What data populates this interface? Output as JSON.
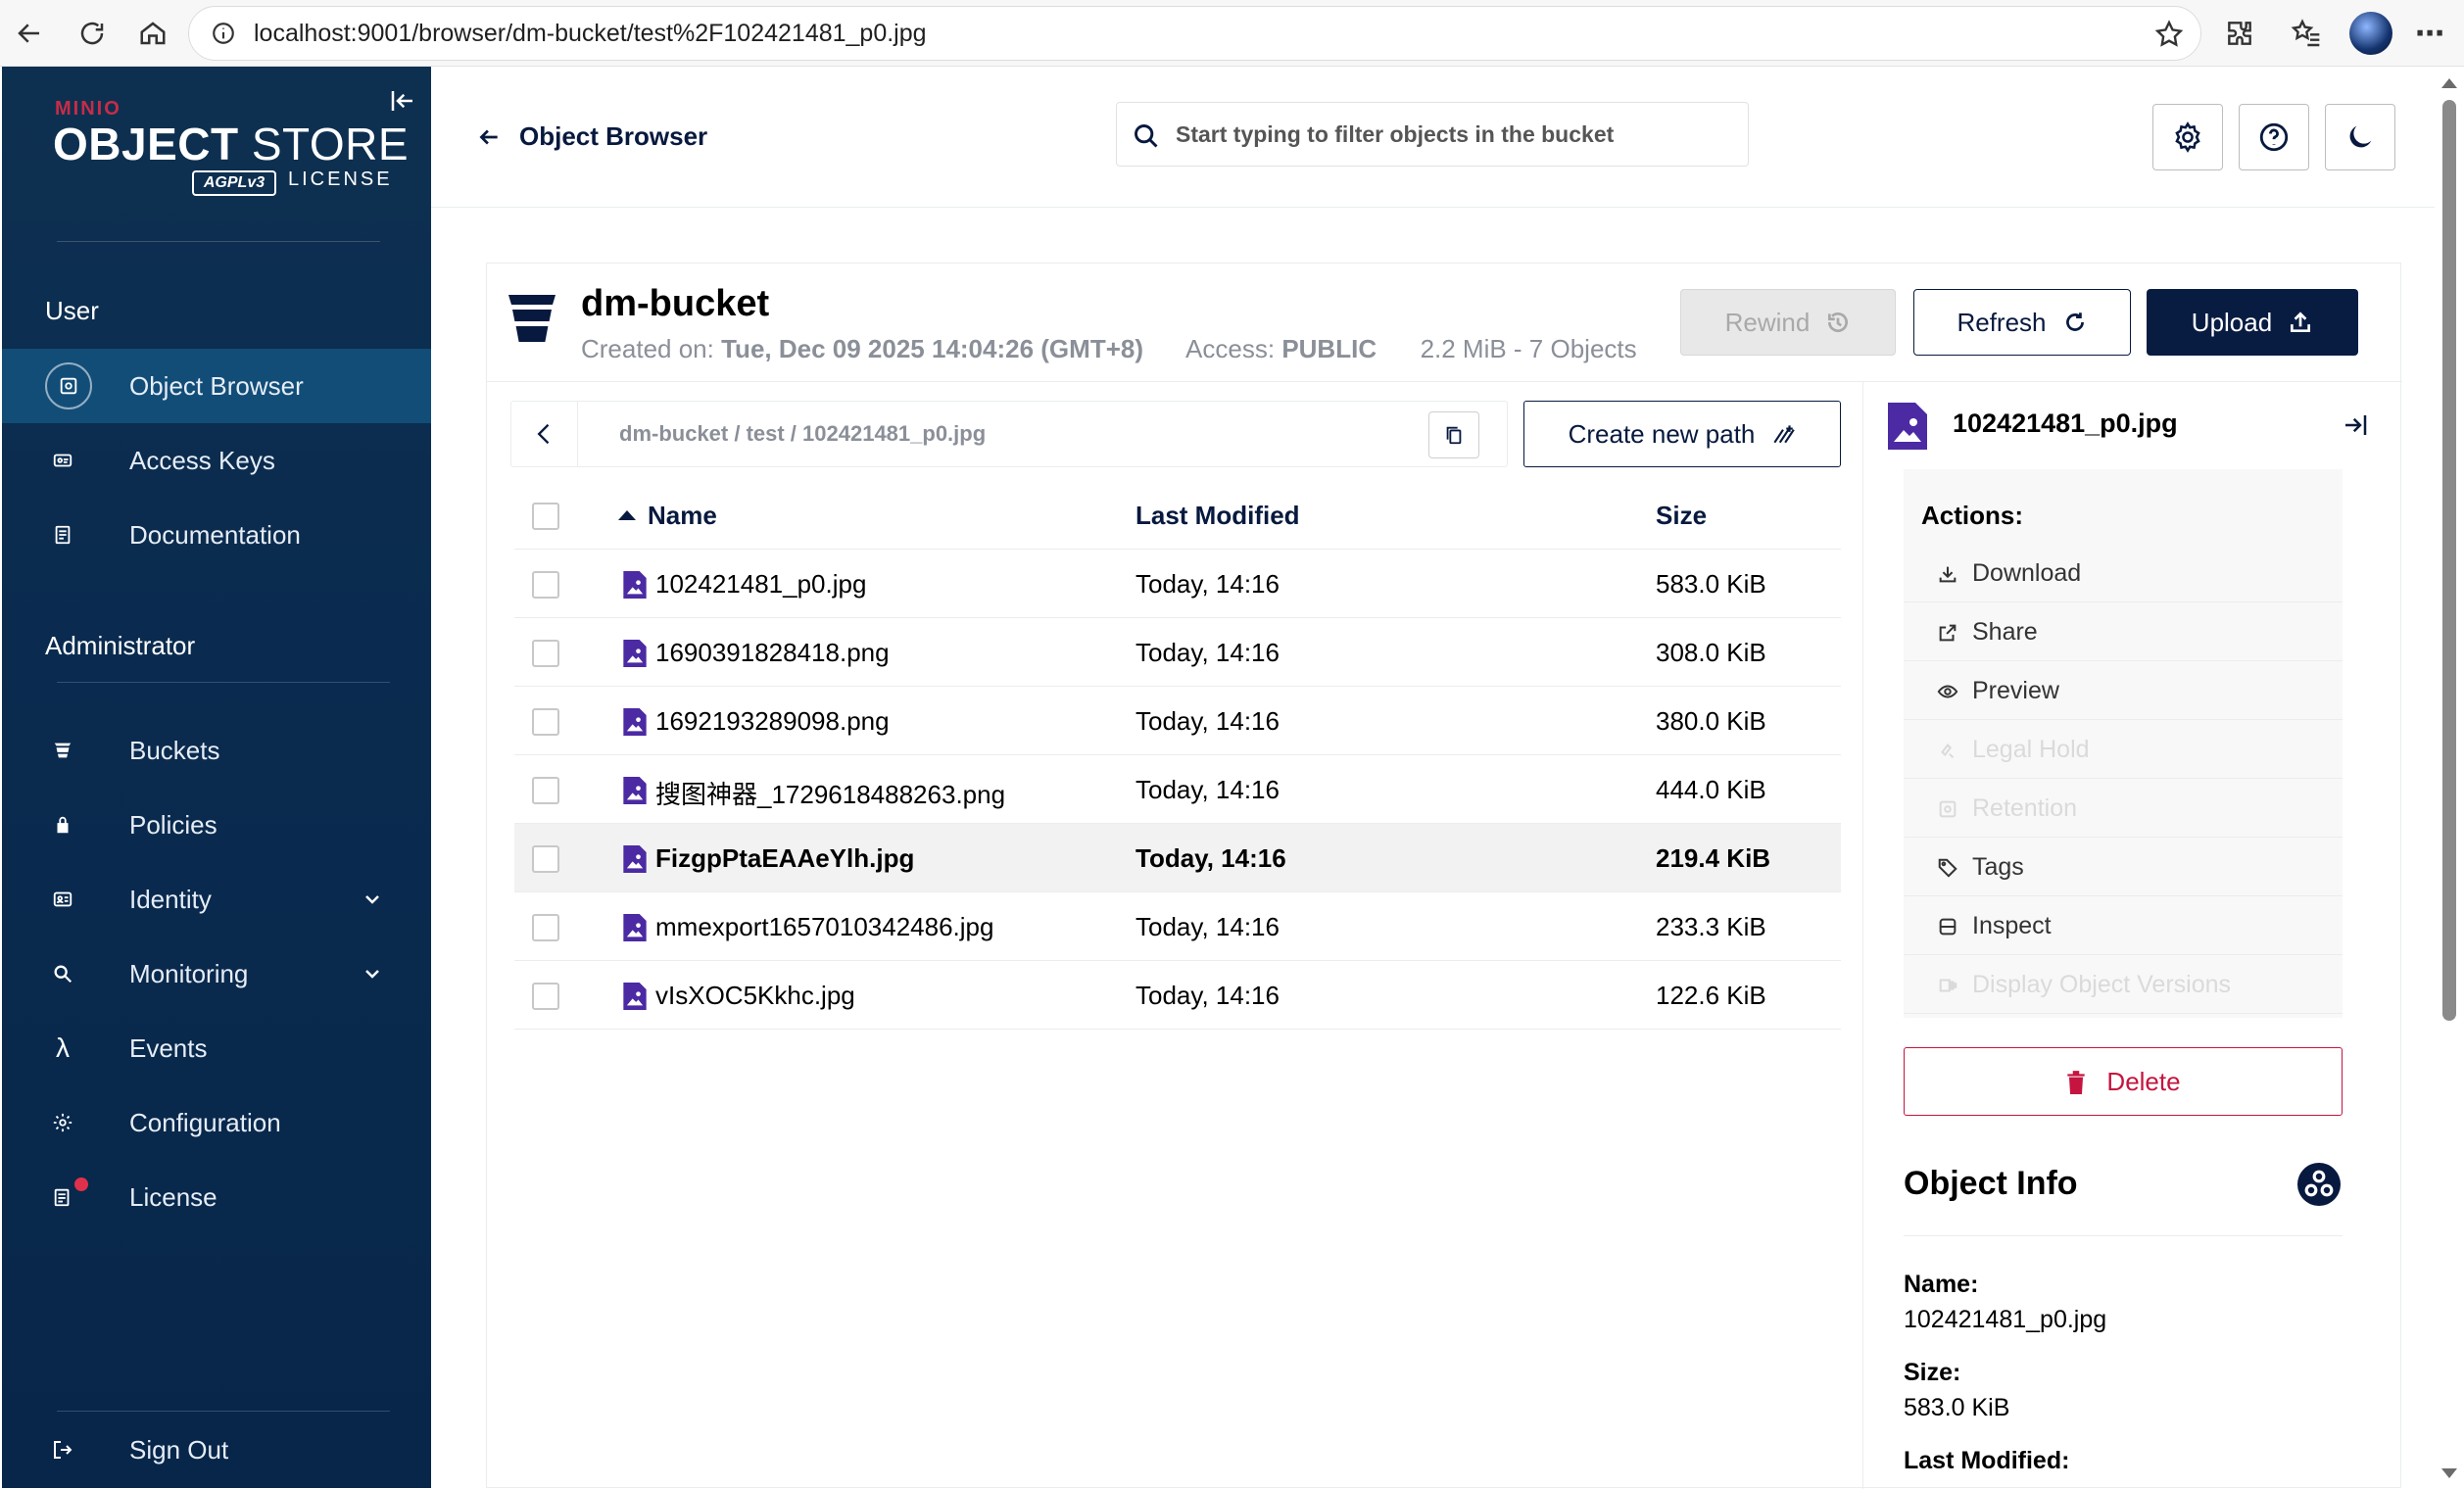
{
  "browser": {
    "url": "localhost:9001/browser/dm-bucket/test%2F102421481_p0.jpg"
  },
  "sidebar": {
    "logo": {
      "brand": "MINIO",
      "title_bold": "OBJECT",
      "title_rest": " STORE",
      "badge": "AGPLv3",
      "license": "LICENSE"
    },
    "user_section": "User",
    "user_items": [
      {
        "label": "Object Browser",
        "icon": "object-browser-icon"
      },
      {
        "label": "Access Keys",
        "icon": "access-keys-icon"
      },
      {
        "label": "Documentation",
        "icon": "documentation-icon"
      }
    ],
    "admin_section": "Administrator",
    "admin_items": [
      {
        "label": "Buckets",
        "icon": "buckets-icon"
      },
      {
        "label": "Policies",
        "icon": "policies-icon"
      },
      {
        "label": "Identity",
        "icon": "identity-icon"
      },
      {
        "label": "Monitoring",
        "icon": "monitoring-icon"
      },
      {
        "label": "Events",
        "icon": "lambda-icon"
      },
      {
        "label": "Configuration",
        "icon": "configuration-icon"
      },
      {
        "label": "License",
        "icon": "license-icon"
      }
    ],
    "sign_out": "Sign Out"
  },
  "header": {
    "back_label": "Object Browser",
    "search_placeholder": "Start typing to filter objects in the bucket"
  },
  "bucket": {
    "name": "dm-bucket",
    "created_label": "Created on:",
    "created_value": "Tue, Dec 09 2025 14:04:26 (GMT+8)",
    "access_label": "Access:",
    "access_value": "PUBLIC",
    "summary": "2.2 MiB - 7 Objects",
    "rewind_label": "Rewind",
    "refresh_label": "Refresh",
    "upload_label": "Upload"
  },
  "breadcrumb": {
    "path": "dm-bucket / test / 102421481_p0.jpg",
    "new_path_label": "Create new path"
  },
  "table": {
    "columns": {
      "name": "Name",
      "modified": "Last Modified",
      "size": "Size"
    },
    "rows": [
      {
        "name": "102421481_p0.jpg",
        "modified": "Today, 14:16",
        "size": "583.0 KiB"
      },
      {
        "name": "1690391828418.png",
        "modified": "Today, 14:16",
        "size": "308.0 KiB"
      },
      {
        "name": "1692193289098.png",
        "modified": "Today, 14:16",
        "size": "380.0 KiB"
      },
      {
        "name": "搜图神器_1729618488263.png",
        "modified": "Today, 14:16",
        "size": "444.0 KiB"
      },
      {
        "name": "FizgpPtaEAAeYlh.jpg",
        "modified": "Today, 14:16",
        "size": "219.4 KiB"
      },
      {
        "name": "mmexport1657010342486.jpg",
        "modified": "Today, 14:16",
        "size": "233.3 KiB"
      },
      {
        "name": "vIsXOC5Kkhc.jpg",
        "modified": "Today, 14:16",
        "size": "122.6 KiB"
      }
    ]
  },
  "detail": {
    "file_name": "102421481_p0.jpg",
    "actions_title": "Actions:",
    "actions": [
      {
        "label": "Download",
        "enabled": true
      },
      {
        "label": "Share",
        "enabled": true
      },
      {
        "label": "Preview",
        "enabled": true
      },
      {
        "label": "Legal Hold",
        "enabled": false
      },
      {
        "label": "Retention",
        "enabled": false
      },
      {
        "label": "Tags",
        "enabled": true
      },
      {
        "label": "Inspect",
        "enabled": true
      },
      {
        "label": "Display Object Versions",
        "enabled": false
      }
    ],
    "delete_label": "Delete",
    "info_title": "Object Info",
    "info": {
      "name_label": "Name:",
      "name_value": "102421481_p0.jpg",
      "size_label": "Size:",
      "size_value": "583.0 KiB",
      "modified_label": "Last Modified:"
    }
  },
  "colors": {
    "sidebar_bg": "#0a2b4f",
    "accent_navy": "#081c42",
    "file_icon": "#4b2aa3",
    "danger": "#c5143f"
  }
}
